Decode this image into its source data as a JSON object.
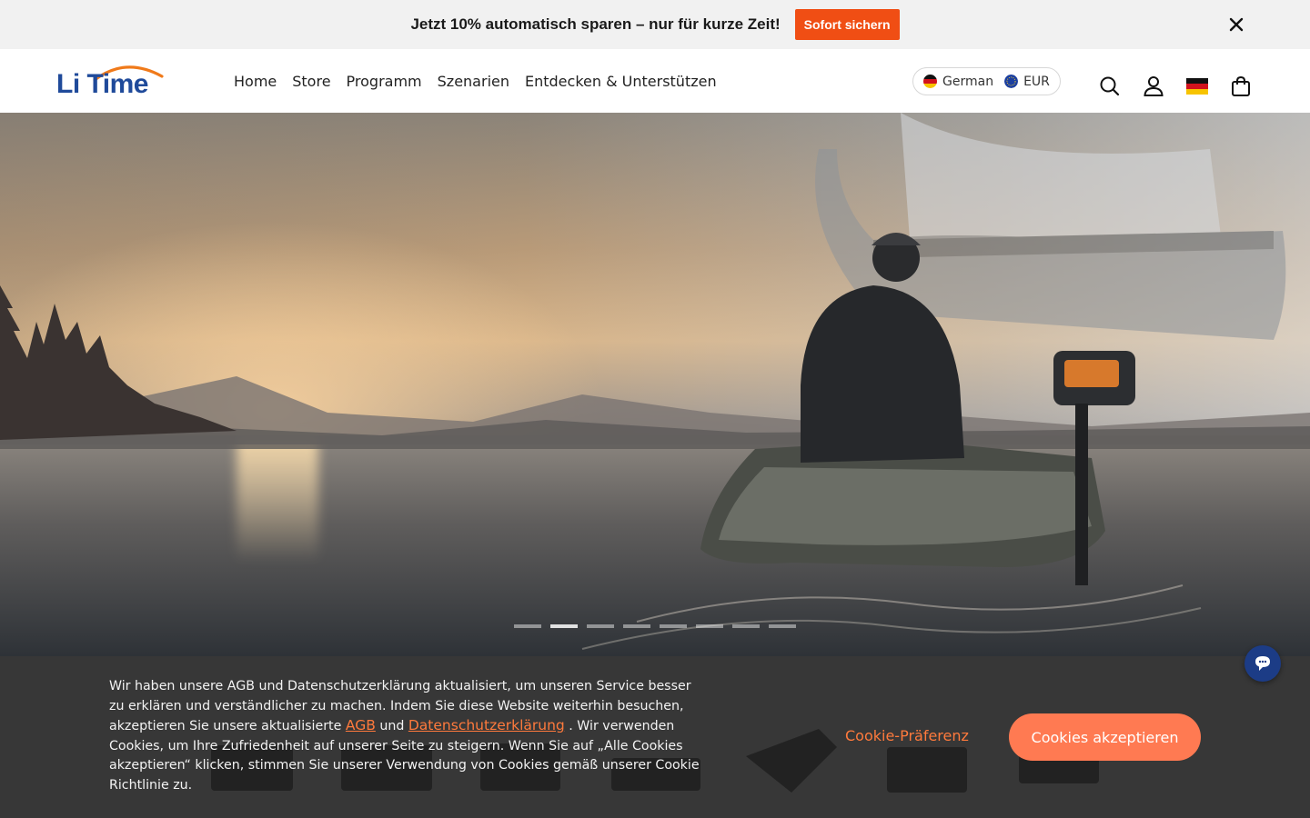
{
  "announcement": {
    "text": "Jetzt 10% automatisch sparen – nur für kurze Zeit!",
    "cta_label": "Sofort sichern",
    "cta_color": "#f04e14"
  },
  "brand": {
    "name": "Li Time",
    "color": "#1f4a9a",
    "accent": "#f07a1a"
  },
  "nav": {
    "items": [
      {
        "label": "Home"
      },
      {
        "label": "Store"
      },
      {
        "label": "Programm"
      },
      {
        "label": "Szenarien"
      },
      {
        "label": "Entdecken & Unterstützen"
      }
    ]
  },
  "locale": {
    "language": "German",
    "currency": "EUR"
  },
  "header_icons": [
    "search-icon",
    "account-icon",
    "germany-flag-icon",
    "cart-icon"
  ],
  "hero": {
    "slide_count": 8,
    "active_slide": 2
  },
  "cookie": {
    "text_before": "Wir haben unsere AGB und Datenschutzerklärung aktualisiert, um unseren Service besser zu erklären und verständlicher zu machen. Indem Sie diese Website weiterhin besuchen, akzeptieren Sie unsere aktualisierte ",
    "link_agb": "AGB",
    "text_and": " und ",
    "link_privacy": "Datenschutzerklärung",
    "text_after": " . Wir verwenden Cookies, um Ihre Zufriedenheit auf unserer Seite zu steigern. Wenn Sie auf „Alle Cookies akzeptieren“ klicken, stimmen Sie unserer Verwendung von Cookies gemäß unserer Cookie Richtlinie zu.",
    "preference_label": "Cookie-Präferenz",
    "accept_label": "Cookies akzeptieren",
    "link_color": "#ff7a3c",
    "accept_color": "#ff7a52"
  }
}
